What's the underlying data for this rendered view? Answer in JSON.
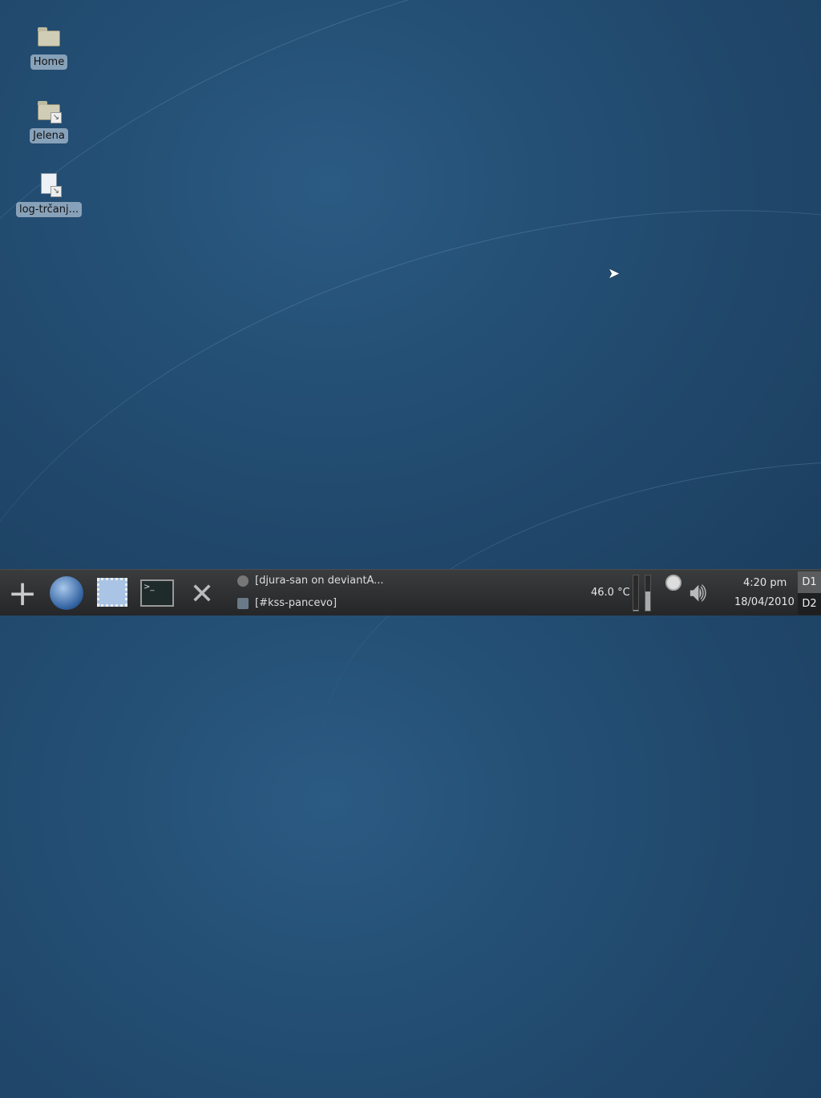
{
  "desktop": {
    "icons": [
      {
        "label": "Home",
        "icon": "home-folder-icon"
      },
      {
        "label": "Jelena",
        "icon": "folder-link-icon"
      },
      {
        "label": "log-trčanj...",
        "icon": "spreadsheet-link-icon"
      }
    ]
  },
  "panel": {
    "launchers": [
      "add-widget-icon",
      "web-browser-icon",
      "mail-client-icon",
      "terminal-icon",
      "settings-tools-icon"
    ],
    "tasks": [
      {
        "label": "[djura-san on deviantA...",
        "icon": "browser-task-icon"
      },
      {
        "label": "[#kss-pancevo]",
        "icon": "chat-task-icon"
      }
    ],
    "temperature": "46.0 °C",
    "meters": [
      0.02,
      0.55
    ],
    "clock": {
      "time": "4:20 pm",
      "date": "18/04/2010"
    },
    "desktops": [
      {
        "label": "D1",
        "active": true
      },
      {
        "label": "D2",
        "active": false
      }
    ]
  }
}
